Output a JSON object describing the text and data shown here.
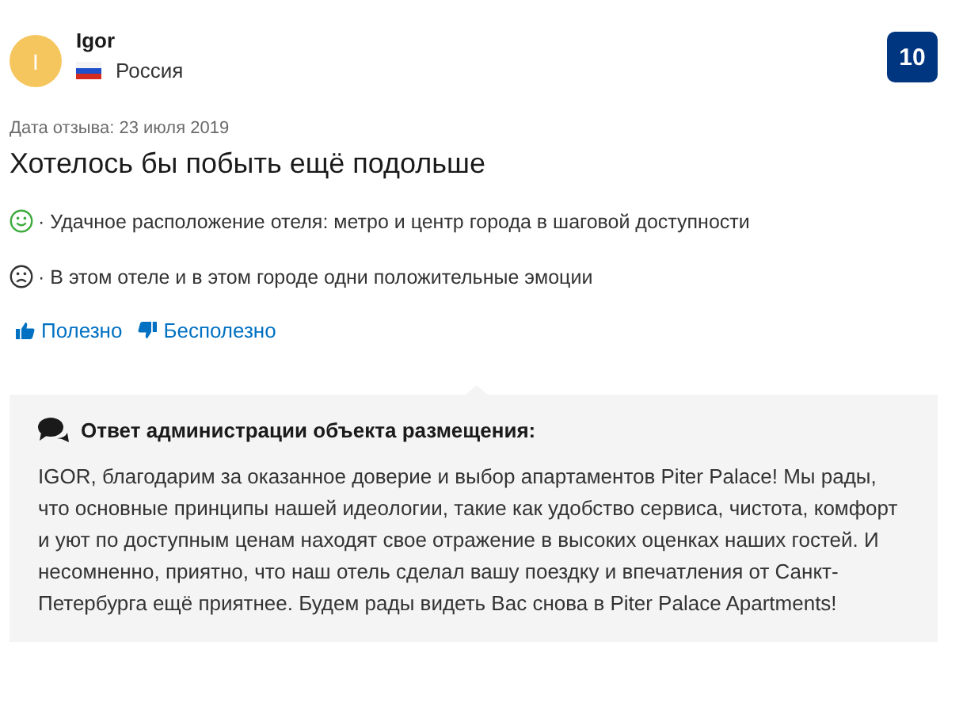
{
  "reviewer": {
    "initial": "I",
    "name": "Igor",
    "country": "Россия"
  },
  "score": "10",
  "review_date": "Дата отзыва: 23 июля 2019",
  "title": "Хотелось бы побыть ещё подольше",
  "comments": [
    {
      "kind": "positive",
      "text": "· Удачное расположение отеля: метро и центр города в шаговой доступности"
    },
    {
      "kind": "negative",
      "text": "· В этом отеле и в этом городе одни положительные эмоции"
    }
  ],
  "votes": [
    {
      "kind": "up",
      "label": "Полезно"
    },
    {
      "kind": "down",
      "label": "Бесполезно"
    }
  ],
  "reply": {
    "heading": "Ответ администрации объекта размещения:",
    "text": "IGOR, благодарим за оказанное доверие и выбор апартаментов Piter Palace! Мы рады, что основные принципы нашей идеологии, такие как удобство сервиса, чистота, комфорт и уют по доступным ценам находят свое отражение в высоких оценках наших гостей. И несомненно, приятно, что наш отель сделал вашу поездку и впечатления от Санкт-Петербурга ещё приятнее. Будем рады видеть Вас снова в Piter Palace Apartments!"
  }
}
